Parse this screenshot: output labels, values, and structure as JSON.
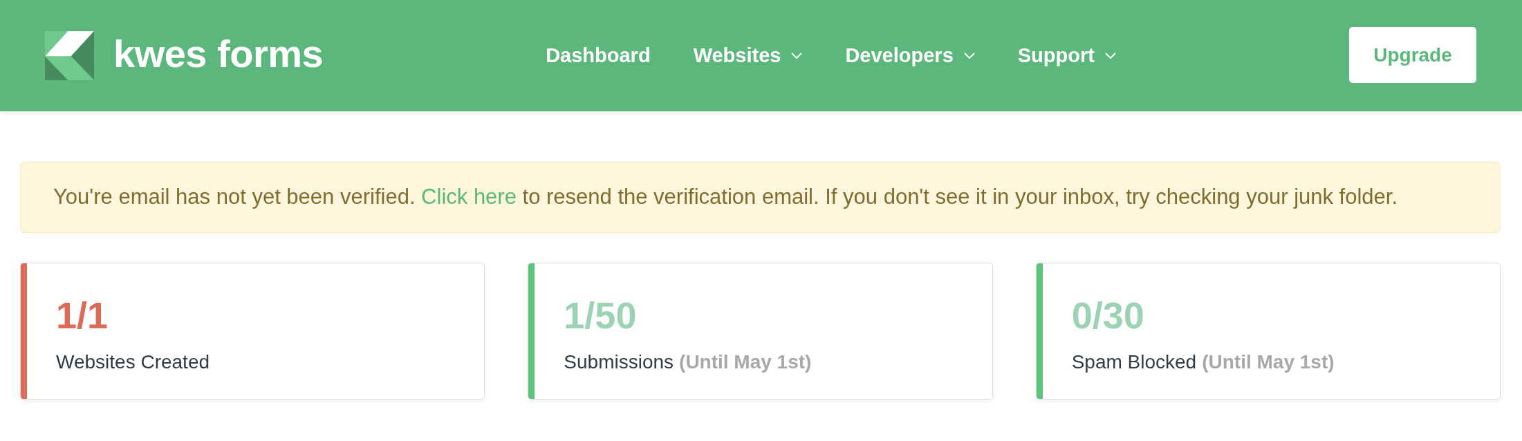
{
  "header": {
    "logo_text": "kwes forms",
    "nav": [
      {
        "label": "Dashboard",
        "kind": "link"
      },
      {
        "label": "Websites",
        "kind": "dropdown"
      },
      {
        "label": "Developers",
        "kind": "dropdown"
      },
      {
        "label": "Support",
        "kind": "dropdown"
      }
    ],
    "upgrade_button": "Upgrade"
  },
  "alert": {
    "text_before": "You're email has not yet been verified.",
    "link": "Click here",
    "text_after": "to resend the verification email. If you don't see it in your inbox, try checking your junk folder."
  },
  "stats": [
    {
      "value": "1/1",
      "label": "Websites Created",
      "limit_reached": true
    },
    {
      "value": "1/50",
      "label": "Submissions",
      "note": "(Until May 1st)",
      "limit_reached": false
    },
    {
      "value": "0/30",
      "label": "Spam Blocked",
      "note": "(Until May 1st)",
      "limit_reached": false
    }
  ]
}
